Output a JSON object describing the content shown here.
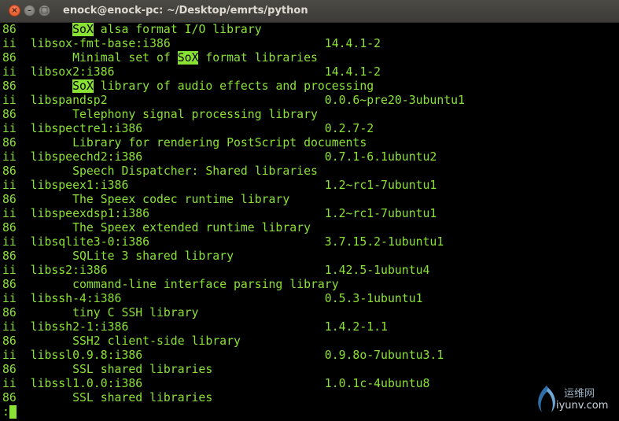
{
  "window": {
    "title": "enock@enock-pc: ~/Desktop/emrts/python",
    "close_glyph": "×",
    "minimize_glyph": "–",
    "maximize_glyph": "□"
  },
  "colors": {
    "terminal_text": "#8ae234",
    "terminal_background": "#000000",
    "highlight_background": "#8ae234",
    "highlight_text": "#000000",
    "titlebar": "#3c3b37"
  },
  "terminal": {
    "lines": [
      [
        {
          "t": "86        "
        },
        {
          "t": "SoX",
          "hl": true
        },
        {
          "t": " alsa format I/O library"
        }
      ],
      [
        {
          "t": "ii  libsox-fmt-base:i386                      14.4.1-2                                   i3"
        }
      ],
      [
        {
          "t": "86        Minimal set of "
        },
        {
          "t": "SoX",
          "hl": true
        },
        {
          "t": " format libraries"
        }
      ],
      [
        {
          "t": "ii  libsox2:i386                              14.4.1-2                                   i3"
        }
      ],
      [
        {
          "t": "86        "
        },
        {
          "t": "SoX",
          "hl": true
        },
        {
          "t": " library of audio effects and processing"
        }
      ],
      [
        {
          "t": "ii  libspandsp2                               0.0.6~pre20-3ubuntu1                       i3"
        }
      ],
      [
        {
          "t": "86        Telephony signal processing library"
        }
      ],
      [
        {
          "t": "ii  libspectre1:i386                          0.2.7-2                                    i3"
        }
      ],
      [
        {
          "t": "86        Library for rendering PostScript documents"
        }
      ],
      [
        {
          "t": "ii  libspeechd2:i386                          0.7.1-6.1ubuntu2                           i3"
        }
      ],
      [
        {
          "t": "86        Speech Dispatcher: Shared libraries"
        }
      ],
      [
        {
          "t": "ii  libspeex1:i386                            1.2~rc1-7ubuntu1                           i3"
        }
      ],
      [
        {
          "t": "86        The Speex codec runtime library"
        }
      ],
      [
        {
          "t": "ii  libspeexdsp1:i386                         1.2~rc1-7ubuntu1                           i3"
        }
      ],
      [
        {
          "t": "86        The Speex extended runtime library"
        }
      ],
      [
        {
          "t": "ii  libsqlite3-0:i386                         3.7.15.2-1ubuntu1                          i3"
        }
      ],
      [
        {
          "t": "86        SQLite 3 shared library"
        }
      ],
      [
        {
          "t": "ii  libss2:i386                               1.42.5-1ubuntu4                            i3"
        }
      ],
      [
        {
          "t": "86        command-line interface parsing library"
        }
      ],
      [
        {
          "t": "ii  libssh-4:i386                             0.5.3-1ubuntu1                             i3"
        }
      ],
      [
        {
          "t": "86        tiny C SSH library"
        }
      ],
      [
        {
          "t": "ii  libssh2-1:i386                            1.4.2-1.1                                  i3"
        }
      ],
      [
        {
          "t": "86        SSH2 client-side library"
        }
      ],
      [
        {
          "t": "ii  libssl0.9.8:i386                          0.9.8o-7ubuntu3.1                          i3"
        }
      ],
      [
        {
          "t": "86        SSL shared libraries"
        }
      ],
      [
        {
          "t": "ii  libssl1.0.0:i386                          1.0.1c-4ubuntu8                            i3"
        }
      ],
      [
        {
          "t": "86        SSL shared libraries"
        }
      ]
    ],
    "prompt": ":"
  },
  "watermark": {
    "chinese": "运维网",
    "url": "iyunv.com"
  }
}
